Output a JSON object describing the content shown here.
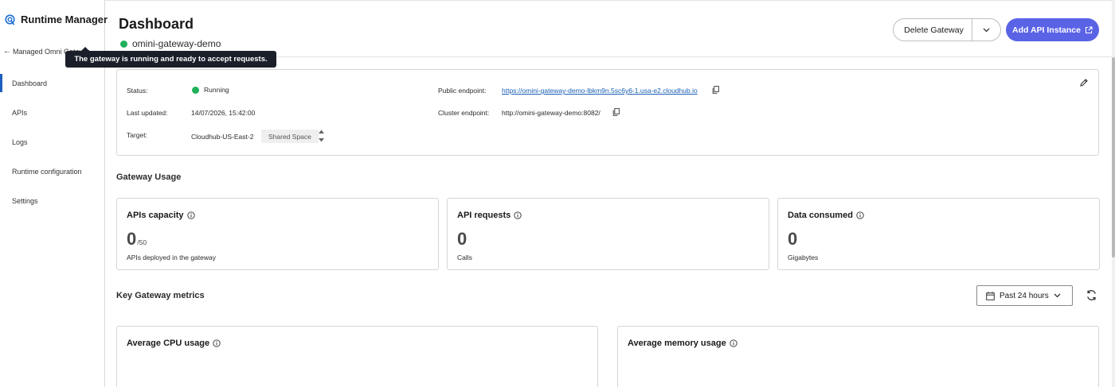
{
  "sidebar": {
    "brand": "Runtime Manager",
    "back_label": "Managed Omni Gateways",
    "items": [
      {
        "label": "Dashboard"
      },
      {
        "label": "APIs"
      },
      {
        "label": "Logs"
      },
      {
        "label": "Runtime configuration"
      },
      {
        "label": "Settings"
      }
    ],
    "active_index": 0
  },
  "tooltip": "The gateway is running and ready to accept requests.",
  "header": {
    "title": "Dashboard",
    "gateway_name": "omini-gateway-demo",
    "delete_label": "Delete Gateway",
    "add_label": "Add API Instance"
  },
  "details": {
    "status_label": "Status:",
    "status_value": "Running",
    "last_updated_label": "Last updated:",
    "last_updated_value": "14/07/2026, 15:42:00",
    "target_label": "Target:",
    "target_value": "Cloudhub-US-East-2",
    "target_chip": "Shared Space",
    "public_label": "Public endpoint:",
    "public_value": "https://omini-gateway-demo-lbkm9n.5sc6y6-1.usa-e2.cloudhub.io",
    "cluster_label": "Cluster endpoint:",
    "cluster_value": "http://omini-gateway-demo:8082/"
  },
  "usage": {
    "title": "Gateway Usage",
    "cards": [
      {
        "title": "APIs capacity",
        "value": "0",
        "suffix": "/50",
        "caption": "APIs deployed in the gateway"
      },
      {
        "title": "API requests",
        "value": "0",
        "suffix": "",
        "caption": "Calls"
      },
      {
        "title": "Data consumed",
        "value": "0",
        "suffix": "",
        "caption": "Gigabytes"
      }
    ]
  },
  "metrics": {
    "title": "Key Gateway metrics",
    "range": "Past 24 hours",
    "cards": [
      {
        "title": "Average CPU usage"
      },
      {
        "title": "Average memory usage"
      }
    ]
  },
  "colors": {
    "accent": "#5a63e6",
    "running": "#20b15a",
    "link": "#1a5fb4",
    "nav_active": "#1f5fbf"
  }
}
